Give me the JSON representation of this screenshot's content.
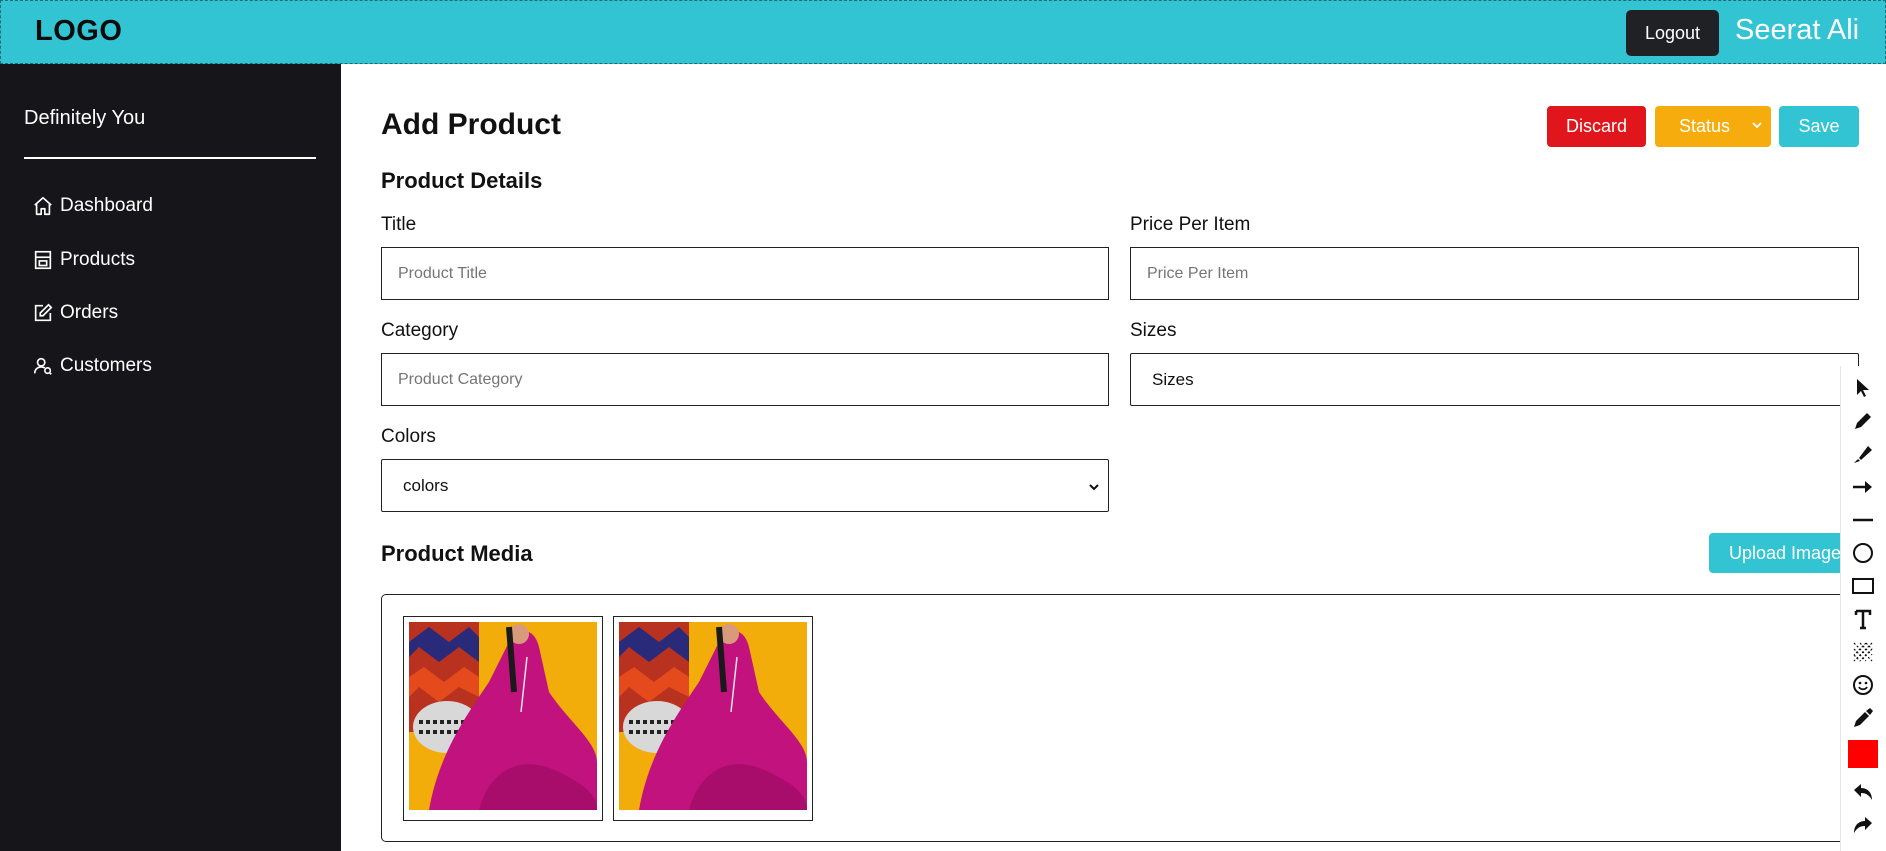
{
  "header": {
    "logo": "LOGO",
    "logout_label": "Logout",
    "username": "Seerat Ali",
    "bg_color": "#33c4d4"
  },
  "sidebar": {
    "brand": "Definitely You",
    "items": [
      {
        "label": "Dashboard",
        "icon": "home-icon"
      },
      {
        "label": "Products",
        "icon": "store-icon"
      },
      {
        "label": "Orders",
        "icon": "edit-icon"
      },
      {
        "label": "Customers",
        "icon": "users-icon"
      }
    ]
  },
  "page": {
    "title": "Add Product",
    "actions": {
      "discard": "Discard",
      "status": "Status",
      "save": "Save"
    }
  },
  "product_details": {
    "heading": "Product Details",
    "title_label": "Title",
    "title_placeholder": "Product Title",
    "price_label": "Price Per Item",
    "price_placeholder": "Price Per Item",
    "category_label": "Category",
    "category_placeholder": "Product Category",
    "sizes_label": "Sizes",
    "sizes_value": "Sizes",
    "colors_label": "Colors",
    "colors_value": "colors"
  },
  "product_media": {
    "heading": "Product Media",
    "upload_label": "Upload Images",
    "images": [
      {
        "alt": "pink embroidered dress product photo"
      },
      {
        "alt": "pink embroidered dress product photo"
      }
    ]
  },
  "annotation_toolbar": {
    "tools": [
      "cursor-icon",
      "pen-icon",
      "highlighter-icon",
      "arrow-icon",
      "line-icon",
      "circle-icon",
      "rectangle-icon",
      "text-icon",
      "blur-icon",
      "emoji-icon",
      "eyedropper-icon",
      "color-swatch",
      "undo-icon",
      "redo-icon"
    ],
    "active_color": "#ff0000"
  },
  "colors": {
    "accent": "#33c4d4",
    "danger": "#e0161c",
    "warning": "#f5ac0c",
    "sidebar_bg": "#16161a"
  }
}
